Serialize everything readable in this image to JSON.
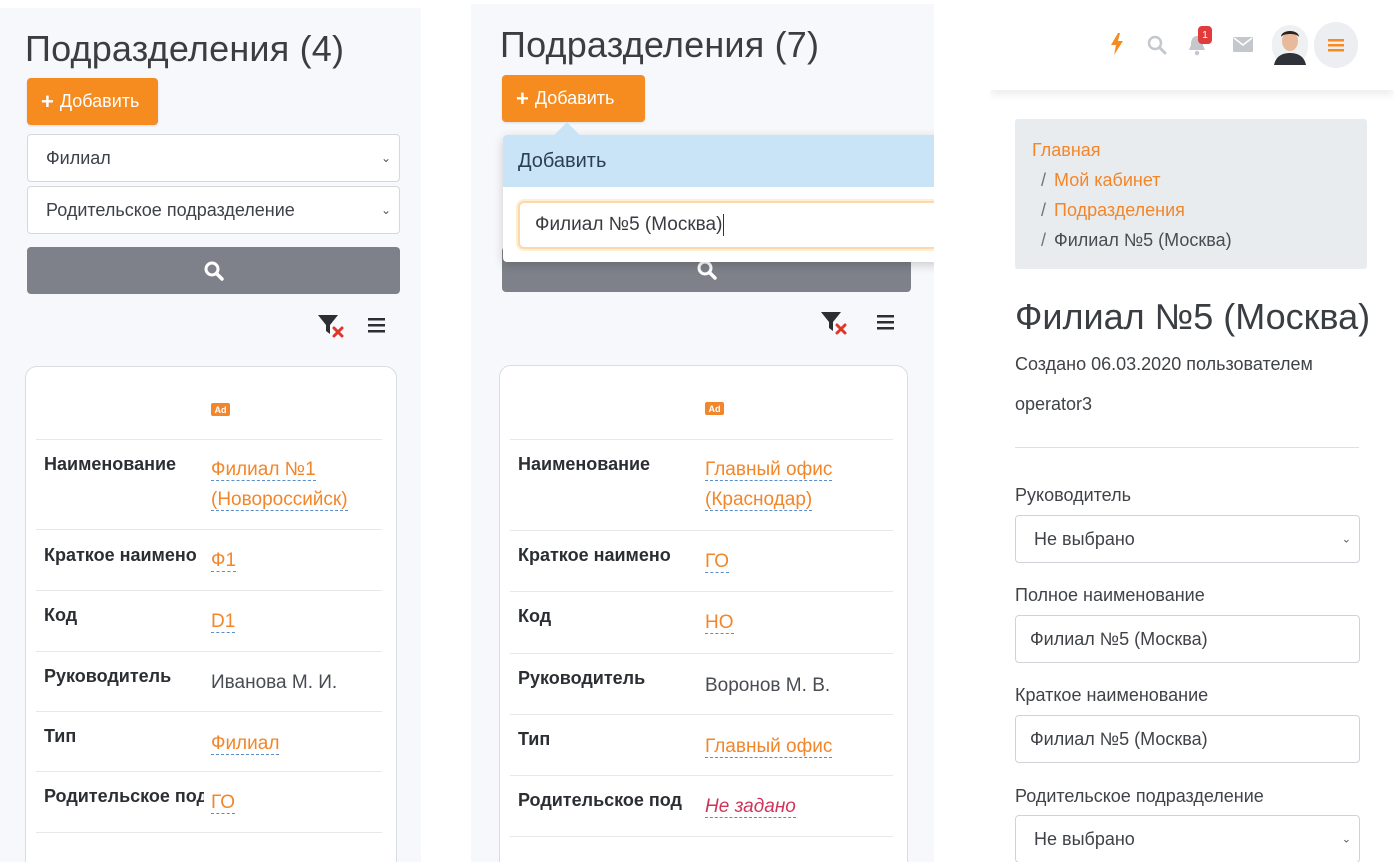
{
  "panel1": {
    "title": "Подразделения (4)",
    "add_label": "Добавить",
    "filter_branch_placeholder": "Филиал",
    "filter_parent_placeholder": "Родительское подразделение",
    "badge": "Ad",
    "rows": [
      {
        "label": "Наименование",
        "value": "Филиал №1",
        "value2": "(Новороссийск)"
      },
      {
        "label": "Краткое наимено",
        "value": "Ф1"
      },
      {
        "label": "Код",
        "value": "D1"
      },
      {
        "label": "Руководитель",
        "value": "Иванова М. И."
      },
      {
        "label": "Тип",
        "value": "Филиал"
      },
      {
        "label": "Родительское под",
        "value": "ГО"
      }
    ]
  },
  "panel2": {
    "title": "Подразделения (7)",
    "add_label": "Добавить",
    "dropdown_header": "Добавить",
    "dropdown_input_value": "Филиал №5 (Москва)",
    "badge": "Ad",
    "rows": [
      {
        "label": "Наименование",
        "value": "Главный офис",
        "value2": "(Краснодар)"
      },
      {
        "label": "Краткое наимено",
        "value": "ГО"
      },
      {
        "label": "Код",
        "value": "НО"
      },
      {
        "label": "Руководитель",
        "value": "Воронов М. В."
      },
      {
        "label": "Тип",
        "value": "Главный офис"
      },
      {
        "label": "Родительское под",
        "value": "Не задано"
      }
    ]
  },
  "panel3": {
    "notification_count": "1",
    "breadcrumb": {
      "home": "Главная",
      "cabinet": "Мой кабинет",
      "units": "Подразделения",
      "current": "Филиал №5 (Москва)",
      "separator": "/"
    },
    "heading": "Филиал №5 (Москва)",
    "created_line1": "Создано 06.03.2020 пользователем",
    "created_line2": "operator3",
    "fields": {
      "manager_label": "Руководитель",
      "manager_value": "Не выбрано",
      "full_name_label": "Полное наименование",
      "full_name_value": "Филиал №5 (Москва)",
      "short_name_label": "Краткое наименование",
      "short_name_value": "Филиал №5 (Москва)",
      "parent_label": "Родительское подразделение",
      "parent_value": "Не выбрано"
    }
  },
  "colors": {
    "accent": "#f68b1f",
    "link": "#f2862a",
    "search_button": "#7e8189",
    "not_set": "#d0345a",
    "dropdown_header": "#c9e3f7"
  },
  "icons": [
    "plus-icon",
    "search-icon",
    "filter-clear-icon",
    "menu-icon",
    "bolt-icon",
    "bell-icon",
    "mail-icon",
    "avatar",
    "hamburger-icon",
    "chevron-down-icon"
  ]
}
